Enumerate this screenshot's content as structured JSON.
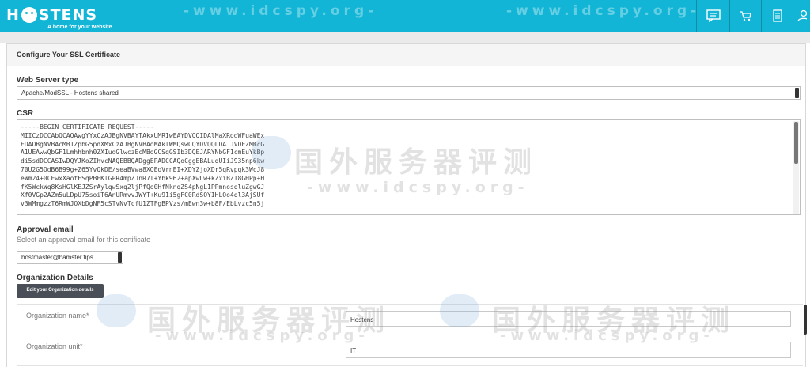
{
  "brand": {
    "name_left": "H",
    "name_right": "STENS",
    "tagline": "A home for your website"
  },
  "header": {
    "icons": [
      "chat-icon",
      "cart-icon",
      "document-icon",
      "user-icon"
    ],
    "accent": "#13b5d6"
  },
  "panel": {
    "title": "Configure Your SSL Certificate"
  },
  "web_server": {
    "label": "Web Server type",
    "selected": "Apache/ModSSL - Hostens shared"
  },
  "csr": {
    "label": "CSR",
    "lines": [
      "-----BEGIN CERTIFICATE REQUEST-----",
      "MIICzDCCAbQCAQAwgYYxCzAJBgNVBAYTAkxUMRIwEAYDVQQIDAlMaXRodWFuaWEx",
      "EDAOBgNVBAcMB1ZpbG5pdXMxCzAJBgNVBAoMAklWMQswCQYDVQQLDAJJVDEZMBcG",
      "A1UEAwwQbGF1Lmhhbnh0ZXIudGlwczEcMBoGCSqGSIb3DQEJARYNbGF1cmEuYkBp",
      "di5sdDCCASIwDQYJKoZIhvcNAQEBBQADggEPADCCAQoCggEBALuqUIiJ935np6kw",
      "70U2G5OdB6B99g+Z65YvQkDE/seaBVwa8XQEoVrnEI+XDYZjoXDr5qRvpqk3WcJ8",
      "eWm24+0CEwxXaofESqPBFKlGPR4mpZJnR7l+Ybk962+apXwLw+kZxiBZT8GHPp+H",
      "fK5WckWq8KsHGlKEJZSrAylqwSxq2ljPfQo0HfNknqZS4pNgL1PPmnosqluZgwGJ",
      "Xf0VGp2AZm5uLDpU75soiT6AnURmvvJWYT+Ku91i5gFC0RdSOYIHLOo4ql3AjSUf",
      "v3WMmgzzT6RmWJOXbDgNF5cSTvNvTcfU1ZTFgBPVzs/mEwn3w+b8F/EbLvzc5n5j"
    ]
  },
  "approval": {
    "label": "Approval email",
    "hint": "Select an approval email for this certificate",
    "selected": "hostmaster@hamster.tips"
  },
  "organization": {
    "label": "Organization Details",
    "edit_button": "Edit your Organization details",
    "fields": [
      {
        "label": "Organization name*",
        "value": "Hostens"
      },
      {
        "label": "Organization unit*",
        "value": "IT"
      }
    ]
  },
  "watermark": {
    "cn": "国外服务器评测",
    "url": "-www.idcspy.org-"
  }
}
